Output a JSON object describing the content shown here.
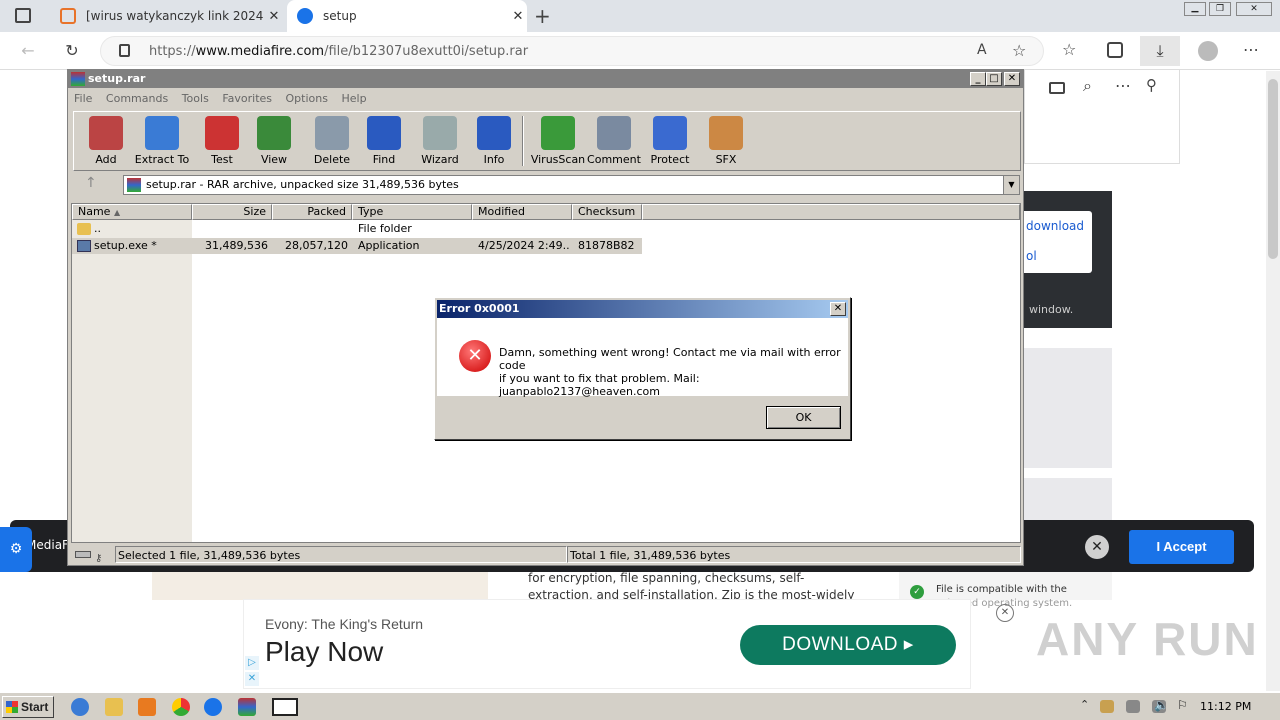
{
  "browser": {
    "tabs": [
      {
        "title": "[wirus watykanczyk link 2024 dow",
        "color": "#e8732a"
      },
      {
        "title": "setup",
        "color": "#1a73e8"
      }
    ],
    "url_prefix": "https://",
    "url_host": "www.mediafire.com",
    "url_path": "/file/b12307u8exutt0i/setup.rar"
  },
  "page": {
    "download_link": "download",
    "tool_link": "ol",
    "window_text": "window.",
    "cookie_prefix": "MediaF",
    "accept_label": "I Accept",
    "desc_line1": "for encryption, file spanning, checksums, self-",
    "desc_line2": "extraction, and self-installation. Zip is the most-widely",
    "compat_line1": "File is compatible with the",
    "compat_line2": "selected operating system.",
    "ad_title": "Evony: The King's Return",
    "ad_headline": "Play Now",
    "ad_button": "DOWNLOAD",
    "watermark": "ANY RUN"
  },
  "winrar": {
    "title": "setup.rar",
    "menu": [
      "File",
      "Commands",
      "Tools",
      "Favorites",
      "Options",
      "Help"
    ],
    "tools": [
      {
        "label": "Add",
        "icon": "add-icon",
        "color": "#b44"
      },
      {
        "label": "Extract To",
        "icon": "extract-icon",
        "color": "#3a7bd5"
      },
      {
        "label": "Test",
        "icon": "test-icon",
        "color": "#c33"
      },
      {
        "label": "View",
        "icon": "view-icon",
        "color": "#3a8a3a"
      },
      {
        "label": "Delete",
        "icon": "delete-icon",
        "color": "#8a9aaa"
      },
      {
        "label": "Find",
        "icon": "find-icon",
        "color": "#2a5ac0"
      },
      {
        "label": "Wizard",
        "icon": "wizard-icon",
        "color": "#9aa"
      },
      {
        "label": "Info",
        "icon": "info-icon",
        "color": "#2a5ac0"
      },
      {
        "label": "VirusScan",
        "icon": "virusscan-icon",
        "color": "#3a9a3a"
      },
      {
        "label": "Comment",
        "icon": "comment-icon",
        "color": "#7a8aa0"
      },
      {
        "label": "Protect",
        "icon": "protect-icon",
        "color": "#3a6ad0"
      },
      {
        "label": "SFX",
        "icon": "sfx-icon",
        "color": "#c84"
      }
    ],
    "path": "setup.rar - RAR archive, unpacked size 31,489,536 bytes",
    "columns": [
      "Name",
      "Size",
      "Packed",
      "Type",
      "Modified",
      "Checksum"
    ],
    "rows": [
      {
        "name": "..",
        "size": "",
        "packed": "",
        "type": "File folder",
        "modified": "",
        "checksum": ""
      },
      {
        "name": "setup.exe *",
        "size": "31,489,536",
        "packed": "28,057,120",
        "type": "Application",
        "modified": "4/25/2024 2:49...",
        "checksum": "81878B82"
      }
    ],
    "status_left": "Selected 1 file, 31,489,536 bytes",
    "status_right": "Total 1 file, 31,489,536 bytes"
  },
  "dialog": {
    "title": "Error 0x0001",
    "message_line1": "Damn, something went wrong! Contact me via mail with error code",
    "message_line2": "if you want to fix that problem. Mail: juanpablo2137@heaven.com",
    "ok_label": "OK"
  },
  "taskbar": {
    "start_label": "Start",
    "clock": "11:12 PM"
  }
}
